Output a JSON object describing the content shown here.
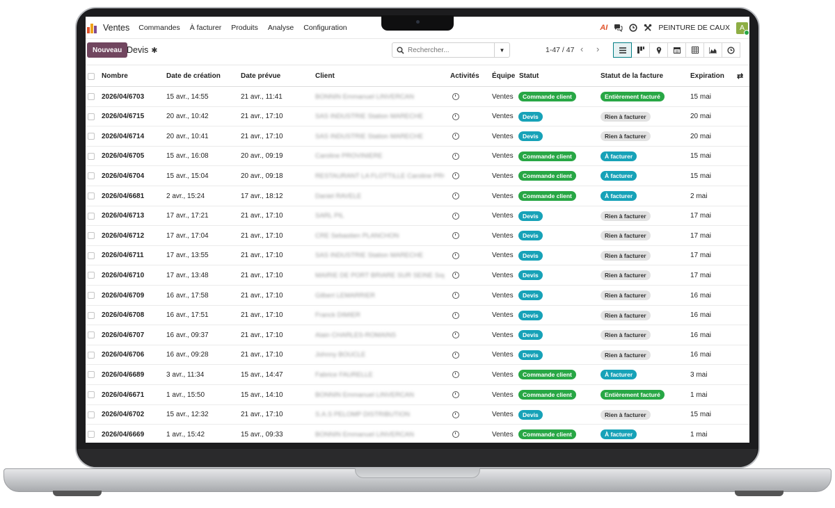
{
  "topbar": {
    "app_name": "Ventes",
    "menu": [
      "Commandes",
      "À facturer",
      "Produits",
      "Analyse",
      "Configuration"
    ],
    "ai_label": "AI",
    "company": "PEINTURE DE CAUX",
    "avatar_letter": "A"
  },
  "control_panel": {
    "new_button": "Nouveau",
    "breadcrumb": "Devis",
    "search_placeholder": "Rechercher...",
    "pager": "1-47 / 47"
  },
  "table": {
    "headers": {
      "number": "Nombre",
      "created": "Date de création",
      "planned": "Date prévue",
      "client": "Client",
      "activities": "Activités",
      "team": "Équipe",
      "status": "Statut",
      "invoice_status": "Statut de la facture",
      "expiration": "Expiration"
    },
    "rows": [
      {
        "number": "2026/04/6703",
        "created": "15 avr., 14:55",
        "planned": "21 avr., 11:41",
        "client": "BONNIN Emmanuel LINVERCAN",
        "team": "Ventes",
        "status": "Commande client",
        "status_color": "green",
        "invoice": "Entièrement facturé",
        "invoice_color": "green",
        "expiration": "15 mai"
      },
      {
        "number": "2026/04/6715",
        "created": "20 avr., 10:42",
        "planned": "21 avr., 17:10",
        "client": "SAS INDUSTRIE Station MARECHE",
        "team": "Ventes",
        "status": "Devis",
        "status_color": "blue",
        "invoice": "Rien à facturer",
        "invoice_color": "grey",
        "expiration": "20 mai"
      },
      {
        "number": "2026/04/6714",
        "created": "20 avr., 10:41",
        "planned": "21 avr., 17:10",
        "client": "SAS INDUSTRIE Station MARECHE",
        "team": "Ventes",
        "status": "Devis",
        "status_color": "blue",
        "invoice": "Rien à facturer",
        "invoice_color": "grey",
        "expiration": "20 mai"
      },
      {
        "number": "2026/04/6705",
        "created": "15 avr., 16:08",
        "planned": "20 avr., 09:19",
        "client": "Caroline PROVINIERE",
        "team": "Ventes",
        "status": "Commande client",
        "status_color": "green",
        "invoice": "À facturer",
        "invoice_color": "blue",
        "expiration": "15 mai"
      },
      {
        "number": "2026/04/6704",
        "created": "15 avr., 15:04",
        "planned": "20 avr., 09:18",
        "client": "RESTAURANT LA FLOTTILLE Caroline PROVI",
        "team": "Ventes",
        "status": "Commande client",
        "status_color": "green",
        "invoice": "À facturer",
        "invoice_color": "blue",
        "expiration": "15 mai"
      },
      {
        "number": "2026/04/6681",
        "created": "2 avr., 15:24",
        "planned": "17 avr., 18:12",
        "client": "Daniel RAVELE",
        "team": "Ventes",
        "status": "Commande client",
        "status_color": "green",
        "invoice": "À facturer",
        "invoice_color": "blue",
        "expiration": "2 mai"
      },
      {
        "number": "2026/04/6713",
        "created": "17 avr., 17:21",
        "planned": "21 avr., 17:10",
        "client": "SARL PIL",
        "team": "Ventes",
        "status": "Devis",
        "status_color": "blue",
        "invoice": "Rien à facturer",
        "invoice_color": "grey",
        "expiration": "17 mai"
      },
      {
        "number": "2026/04/6712",
        "created": "17 avr., 17:04",
        "planned": "21 avr., 17:10",
        "client": "CRE Sebastien PLANCHON",
        "team": "Ventes",
        "status": "Devis",
        "status_color": "blue",
        "invoice": "Rien à facturer",
        "invoice_color": "grey",
        "expiration": "17 mai"
      },
      {
        "number": "2026/04/6711",
        "created": "17 avr., 13:55",
        "planned": "21 avr., 17:10",
        "client": "SAS INDUSTRIE Station MARECHE",
        "team": "Ventes",
        "status": "Devis",
        "status_color": "blue",
        "invoice": "Rien à facturer",
        "invoice_color": "grey",
        "expiration": "17 mai"
      },
      {
        "number": "2026/04/6710",
        "created": "17 avr., 13:48",
        "planned": "21 avr., 17:10",
        "client": "MAIRIE DE PORT BRIARE SUR SEINE Sophie",
        "team": "Ventes",
        "status": "Devis",
        "status_color": "blue",
        "invoice": "Rien à facturer",
        "invoice_color": "grey",
        "expiration": "17 mai"
      },
      {
        "number": "2026/04/6709",
        "created": "16 avr., 17:58",
        "planned": "21 avr., 17:10",
        "client": "Gilbert LEMARRIER",
        "team": "Ventes",
        "status": "Devis",
        "status_color": "blue",
        "invoice": "Rien à facturer",
        "invoice_color": "grey",
        "expiration": "16 mai"
      },
      {
        "number": "2026/04/6708",
        "created": "16 avr., 17:51",
        "planned": "21 avr., 17:10",
        "client": "Franck DIMIER",
        "team": "Ventes",
        "status": "Devis",
        "status_color": "blue",
        "invoice": "Rien à facturer",
        "invoice_color": "grey",
        "expiration": "16 mai"
      },
      {
        "number": "2026/04/6707",
        "created": "16 avr., 09:37",
        "planned": "21 avr., 17:10",
        "client": "Alain CHARLES-ROMAINS",
        "team": "Ventes",
        "status": "Devis",
        "status_color": "blue",
        "invoice": "Rien à facturer",
        "invoice_color": "grey",
        "expiration": "16 mai"
      },
      {
        "number": "2026/04/6706",
        "created": "16 avr., 09:28",
        "planned": "21 avr., 17:10",
        "client": "Johnny BOUCLE",
        "team": "Ventes",
        "status": "Devis",
        "status_color": "blue",
        "invoice": "Rien à facturer",
        "invoice_color": "grey",
        "expiration": "16 mai"
      },
      {
        "number": "2026/04/6689",
        "created": "3 avr., 11:34",
        "planned": "15 avr., 14:47",
        "client": "Fabrice FAURELLE",
        "team": "Ventes",
        "status": "Commande client",
        "status_color": "green",
        "invoice": "À facturer",
        "invoice_color": "blue",
        "expiration": "3 mai"
      },
      {
        "number": "2026/04/6671",
        "created": "1 avr., 15:50",
        "planned": "15 avr., 14:10",
        "client": "BONNIN Emmanuel LINVERCAN",
        "team": "Ventes",
        "status": "Commande client",
        "status_color": "green",
        "invoice": "Entièrement facturé",
        "invoice_color": "green",
        "expiration": "1 mai"
      },
      {
        "number": "2026/04/6702",
        "created": "15 avr., 12:32",
        "planned": "21 avr., 17:10",
        "client": "S.A.S PELOMP DISTRIBUTION",
        "team": "Ventes",
        "status": "Devis",
        "status_color": "blue",
        "invoice": "Rien à facturer",
        "invoice_color": "grey",
        "expiration": "15 mai"
      },
      {
        "number": "2026/04/6669",
        "created": "1 avr., 15:42",
        "planned": "15 avr., 09:33",
        "client": "BONNIN Emmanuel LINVERCAN",
        "team": "Ventes",
        "status": "Commande client",
        "status_color": "green",
        "invoice": "À facturer",
        "invoice_color": "blue",
        "expiration": "1 mai"
      }
    ]
  },
  "colors": {
    "primary": "#71465f",
    "accent": "#017e84",
    "badge_green": "#28a745",
    "badge_blue": "#17a2b8",
    "badge_grey": "#e2e2e2"
  },
  "icons": {
    "views": [
      "list-view-icon",
      "kanban-view-icon",
      "map-view-icon",
      "calendar-view-icon",
      "pivot-view-icon",
      "graph-view-icon",
      "activity-view-icon"
    ]
  }
}
